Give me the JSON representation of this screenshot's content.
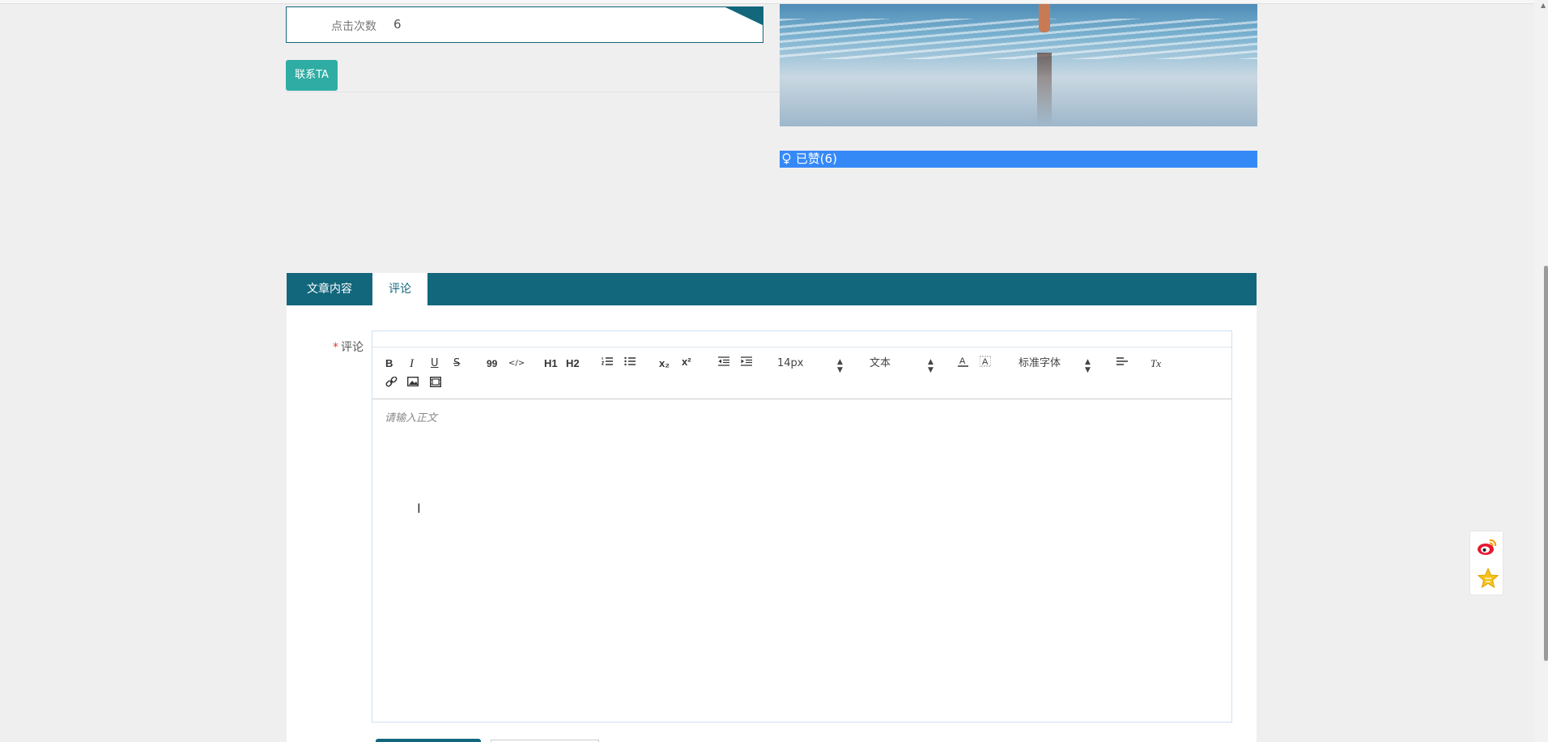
{
  "info": {
    "label": "点击次数",
    "value": "6"
  },
  "contact_button": "联系TA",
  "liked": {
    "icon": "thumbs-up-icon",
    "label": "已赞(6)"
  },
  "tabs": [
    {
      "label": "文章内容"
    },
    {
      "label": "评论"
    }
  ],
  "comment_field": {
    "required_mark": "*",
    "label": "评论",
    "placeholder": "请输入正文"
  },
  "toolbar": {
    "bold": "B",
    "italic": "I",
    "underline": "U",
    "strike": "S",
    "quote": "99",
    "code": "</>",
    "h1": "H1",
    "h2": "H2",
    "subscript": "x₂",
    "superscript": "x²",
    "size": "14px",
    "type": "文本",
    "font": "标准字体",
    "clear": "Tx"
  },
  "colors": {
    "accent": "#12677c",
    "liked": "#3589f7",
    "button": "#2fada4"
  }
}
